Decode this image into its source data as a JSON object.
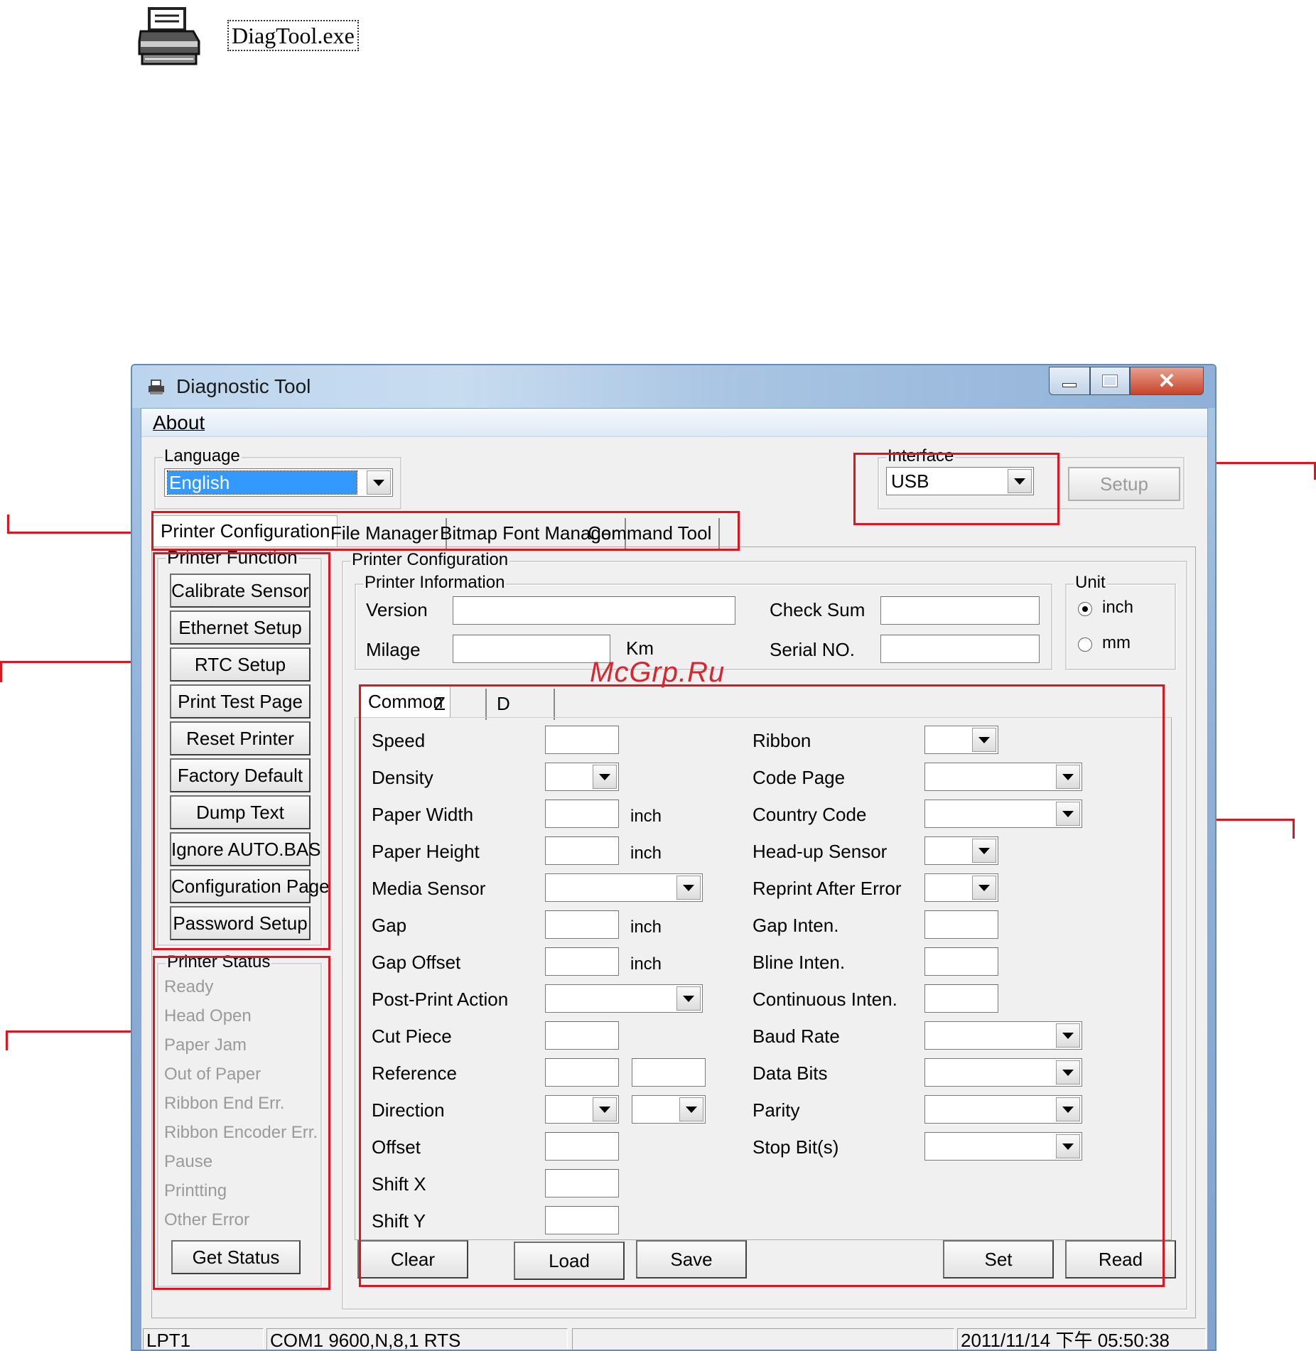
{
  "file": {
    "name": "DiagTool.exe",
    "icon": "printer-icon"
  },
  "window": {
    "title": "Diagnostic Tool",
    "menu": {
      "about": "About"
    },
    "language": {
      "label": "Language",
      "value": "English"
    },
    "interface": {
      "label": "Interface",
      "value": "USB",
      "setup_button": "Setup"
    },
    "tabs": [
      "Printer Configuration",
      "File Manager",
      "Bitmap Font Manager",
      "Command Tool"
    ],
    "printer_function": {
      "label": "Printer Function",
      "buttons": [
        "Calibrate Sensor",
        "Ethernet Setup",
        "RTC Setup",
        "Print Test Page",
        "Reset Printer",
        "Factory Default",
        "Dump Text",
        "Ignore AUTO.BAS",
        "Configuration Page",
        "Password Setup"
      ]
    },
    "printer_status": {
      "label": "Printer Status",
      "items": [
        "Ready",
        "Head Open",
        "Paper Jam",
        "Out of Paper",
        "Ribbon End Err.",
        "Ribbon Encoder Err.",
        "Pause",
        "Printting",
        "Other Error"
      ],
      "get_status": "Get Status"
    },
    "printer_configuration": {
      "label": "Printer Configuration",
      "info": {
        "label": "Printer Information",
        "version": "Version",
        "milage": "Milage",
        "km": "Km",
        "check_sum": "Check Sum",
        "serial_no": "Serial NO."
      },
      "unit": {
        "label": "Unit",
        "inch": "inch",
        "mm": "mm",
        "selected": "inch"
      },
      "subtabs": [
        "Common",
        "Z",
        "D"
      ],
      "left_fields": [
        "Speed",
        "Density",
        "Paper Width",
        "Paper Height",
        "Media Sensor",
        "Gap",
        "Gap Offset",
        "Post-Print Action",
        "Cut Piece",
        "Reference",
        "Direction",
        "Offset",
        "Shift X",
        "Shift Y"
      ],
      "right_fields": [
        "Ribbon",
        "Code Page",
        "Country Code",
        "Head-up Sensor",
        "Reprint After Error",
        "Gap Inten.",
        "Bline Inten.",
        "Continuous Inten.",
        "Baud Rate",
        "Data Bits",
        "Parity",
        "Stop Bit(s)"
      ],
      "unit_inch": "inch",
      "buttons": {
        "clear": "Clear",
        "load": "Load",
        "save": "Save",
        "set": "Set",
        "read": "Read"
      }
    },
    "statusbar": [
      "LPT1",
      "COM1 9600,N,8,1 RTS",
      "",
      "2011/11/14 下午 05:50:38"
    ]
  },
  "watermark": "McGrp.Ru",
  "colors": {
    "annotation": "#e0141f",
    "selection": "#3399ff"
  }
}
